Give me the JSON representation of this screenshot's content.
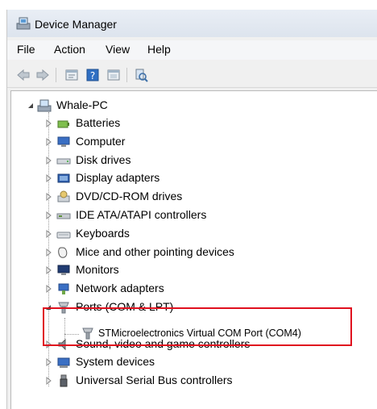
{
  "window": {
    "title": "Device Manager"
  },
  "menu": [
    "File",
    "Action",
    "View",
    "Help"
  ],
  "toolbar": {
    "buttons": [
      "back-arrow-icon",
      "forward-arrow-icon",
      "properties-icon",
      "help-icon",
      "update-driver-icon",
      "scan-hardware-icon"
    ]
  },
  "tree": {
    "root": {
      "label": "Whale-PC",
      "icon": "computer-icon"
    },
    "categories": [
      {
        "label": "Batteries",
        "icon": "battery-icon"
      },
      {
        "label": "Computer",
        "icon": "computer-monitor-icon"
      },
      {
        "label": "Disk drives",
        "icon": "disk-drive-icon"
      },
      {
        "label": "Display adapters",
        "icon": "display-adapter-icon"
      },
      {
        "label": "DVD/CD-ROM drives",
        "icon": "dvd-drive-icon"
      },
      {
        "label": "IDE ATA/ATAPI controllers",
        "icon": "ide-controller-icon"
      },
      {
        "label": "Keyboards",
        "icon": "keyboard-icon"
      },
      {
        "label": "Mice and other pointing devices",
        "icon": "mouse-icon"
      },
      {
        "label": "Monitors",
        "icon": "monitor-icon"
      },
      {
        "label": "Network adapters",
        "icon": "network-adapter-icon"
      },
      {
        "label": "Ports (COM & LPT)",
        "icon": "port-icon",
        "expanded": true,
        "children": [
          {
            "label": "STMicroelectronics Virtual COM Port (COM4)",
            "icon": "port-icon"
          }
        ]
      },
      {
        "label": "Sound, video and game controllers",
        "icon": "sound-icon"
      },
      {
        "label": "System devices",
        "icon": "system-device-icon"
      },
      {
        "label": "Universal Serial Bus controllers",
        "icon": "usb-icon"
      }
    ]
  },
  "highlight_color": "#e0101e"
}
